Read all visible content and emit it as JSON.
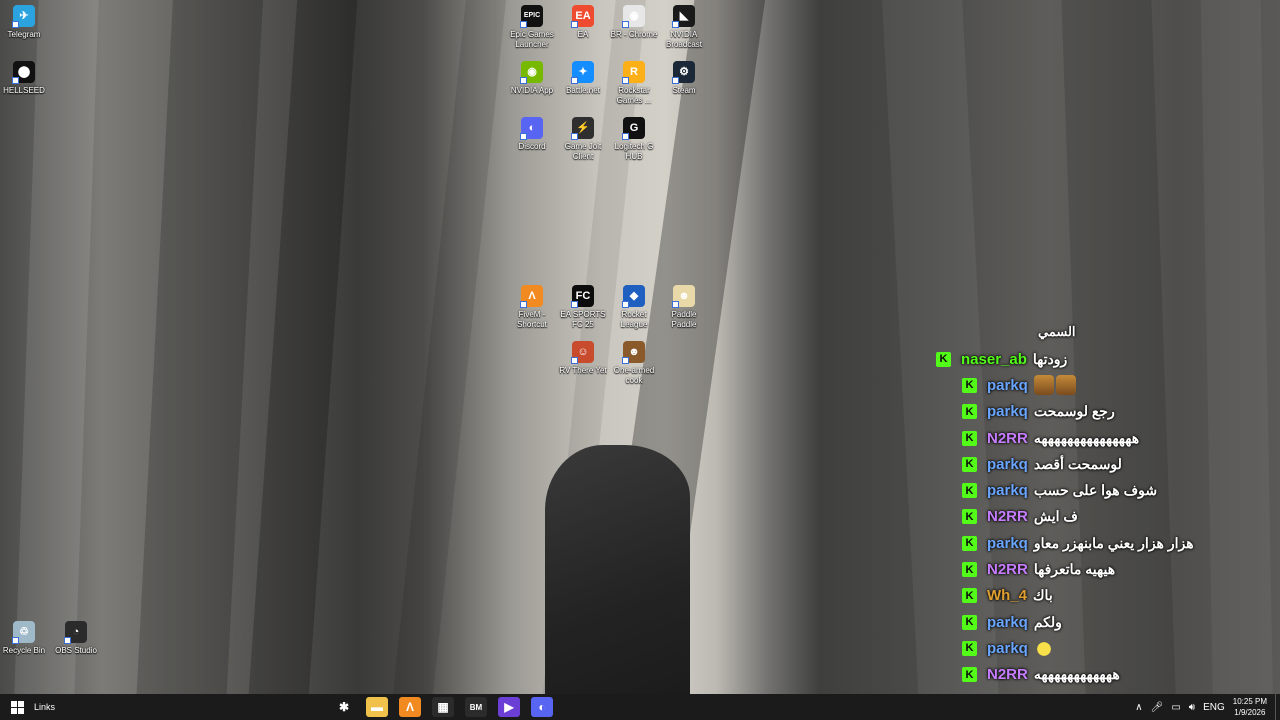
{
  "desktop": {
    "icons": [
      {
        "label": "Telegram",
        "icon": "telegram-icon",
        "color": "#2aa3df",
        "glyph": "✈"
      },
      {
        "label": "HELLSEED",
        "icon": "hellseed-icon",
        "color": "#111111",
        "glyph": "⬤"
      },
      {
        "label": "Epic Games Launcher",
        "icon": "epic-games-icon",
        "color": "#111111",
        "glyph": "EPIC"
      },
      {
        "label": "EA",
        "icon": "ea-icon",
        "color": "#ef4b31",
        "glyph": "EA"
      },
      {
        "label": "BR - Chrome",
        "icon": "chrome-icon",
        "color": "#e7e7e7",
        "glyph": "◉"
      },
      {
        "label": "NVIDIA Broadcast",
        "icon": "nvidia-broadcast-icon",
        "color": "#1a1a1a",
        "glyph": "◣"
      },
      {
        "label": "NVIDIA App",
        "icon": "nvidia-app-icon",
        "color": "#76b900",
        "glyph": "◉"
      },
      {
        "label": "Battle.net",
        "icon": "battlenet-icon",
        "color": "#148eff",
        "glyph": "✦"
      },
      {
        "label": "Rockstar Games ...",
        "icon": "rockstar-icon",
        "color": "#fcaf17",
        "glyph": "R"
      },
      {
        "label": "Steam",
        "icon": "steam-icon",
        "color": "#1b2838",
        "glyph": "⚙"
      },
      {
        "label": "Discord",
        "icon": "discord-icon",
        "color": "#5865f2",
        "glyph": "◐"
      },
      {
        "label": "Game Jolt Client",
        "icon": "gamejolt-icon",
        "color": "#2f2f2f",
        "glyph": "⚡"
      },
      {
        "label": "Logitech G HUB",
        "icon": "logitech-ghub-icon",
        "color": "#111111",
        "glyph": "G"
      },
      {
        "label": "FiveM - Shortcut",
        "icon": "fivem-icon",
        "color": "#f28a22",
        "glyph": "Λ"
      },
      {
        "label": "EA SPORTS FC 25",
        "icon": "ea-sports-fc-icon",
        "color": "#0c0c0c",
        "glyph": "FC"
      },
      {
        "label": "Rocket League",
        "icon": "rocket-league-icon",
        "color": "#1f5fbf",
        "glyph": "◆"
      },
      {
        "label": "Paddle Paddle",
        "icon": "paddle-paddle-icon",
        "color": "#e9d9a8",
        "glyph": "☻"
      },
      {
        "label": "RV There Yet",
        "icon": "rv-there-yet-icon",
        "color": "#c94b2e",
        "glyph": "☺"
      },
      {
        "label": "One-armed cook",
        "icon": "one-armed-cook-icon",
        "color": "#8a5a2b",
        "glyph": "☻"
      },
      {
        "label": "Recycle Bin",
        "icon": "recycle-bin-icon",
        "color": "#9fb9c9",
        "glyph": "♲"
      },
      {
        "label": "OBS Studio",
        "icon": "obs-studio-icon",
        "color": "#2b2b2b",
        "glyph": "◔"
      }
    ]
  },
  "chat": {
    "header": "السمي",
    "messages": [
      {
        "user": "naser_ab",
        "color": "#53fc18",
        "text": "زودتها"
      },
      {
        "user": "parkq",
        "color": "#6aa6ff",
        "text": "",
        "emotes": 2
      },
      {
        "user": "parkq",
        "color": "#6aa6ff",
        "text": "رجع لوسمحت"
      },
      {
        "user": "N2RR",
        "color": "#c77dff",
        "text": "هههههههههههههههه"
      },
      {
        "user": "parkq",
        "color": "#6aa6ff",
        "text": "لوسمحت أقصد"
      },
      {
        "user": "parkq",
        "color": "#6aa6ff",
        "text": "شوف هوا على حسب"
      },
      {
        "user": "N2RR",
        "color": "#c77dff",
        "text": "ف ايش"
      },
      {
        "user": "parkq",
        "color": "#6aa6ff",
        "text": "هزار هزار يعني مابنهزر معاو"
      },
      {
        "user": "N2RR",
        "color": "#c77dff",
        "text": "هيهيه ماتعرفها"
      },
      {
        "user": "Wh_4",
        "color": "#e0a030",
        "text": "باك"
      },
      {
        "user": "parkq",
        "color": "#6aa6ff",
        "text": "ولكم"
      },
      {
        "user": "parkq",
        "color": "#6aa6ff",
        "text": "",
        "emotes": 1
      },
      {
        "user": "N2RR",
        "color": "#c77dff",
        "text": "ههههههههههههه"
      }
    ],
    "badge_letter": "K"
  },
  "taskbar": {
    "links_label": "Links",
    "apps": [
      {
        "icon": "settings-gear-icon",
        "glyph": "✱",
        "color": "#1b1b1b"
      },
      {
        "icon": "file-explorer-icon",
        "glyph": "▬",
        "color": "#f0c24b"
      },
      {
        "icon": "fivem-taskbar-icon",
        "glyph": "Λ",
        "color": "#f28a22"
      },
      {
        "icon": "microsoft-store-icon",
        "glyph": "▦",
        "color": "#2b2b2b"
      },
      {
        "icon": "bm-app-icon",
        "glyph": "BM",
        "color": "#2b2b2b"
      },
      {
        "icon": "media-player-icon",
        "glyph": "▶",
        "color": "#6b3fd6"
      },
      {
        "icon": "discord-taskbar-icon",
        "glyph": "◐",
        "color": "#5865f2"
      }
    ],
    "tray": {
      "language": "ENG",
      "time": "10:25 PM",
      "date": "1/9/2026"
    }
  }
}
